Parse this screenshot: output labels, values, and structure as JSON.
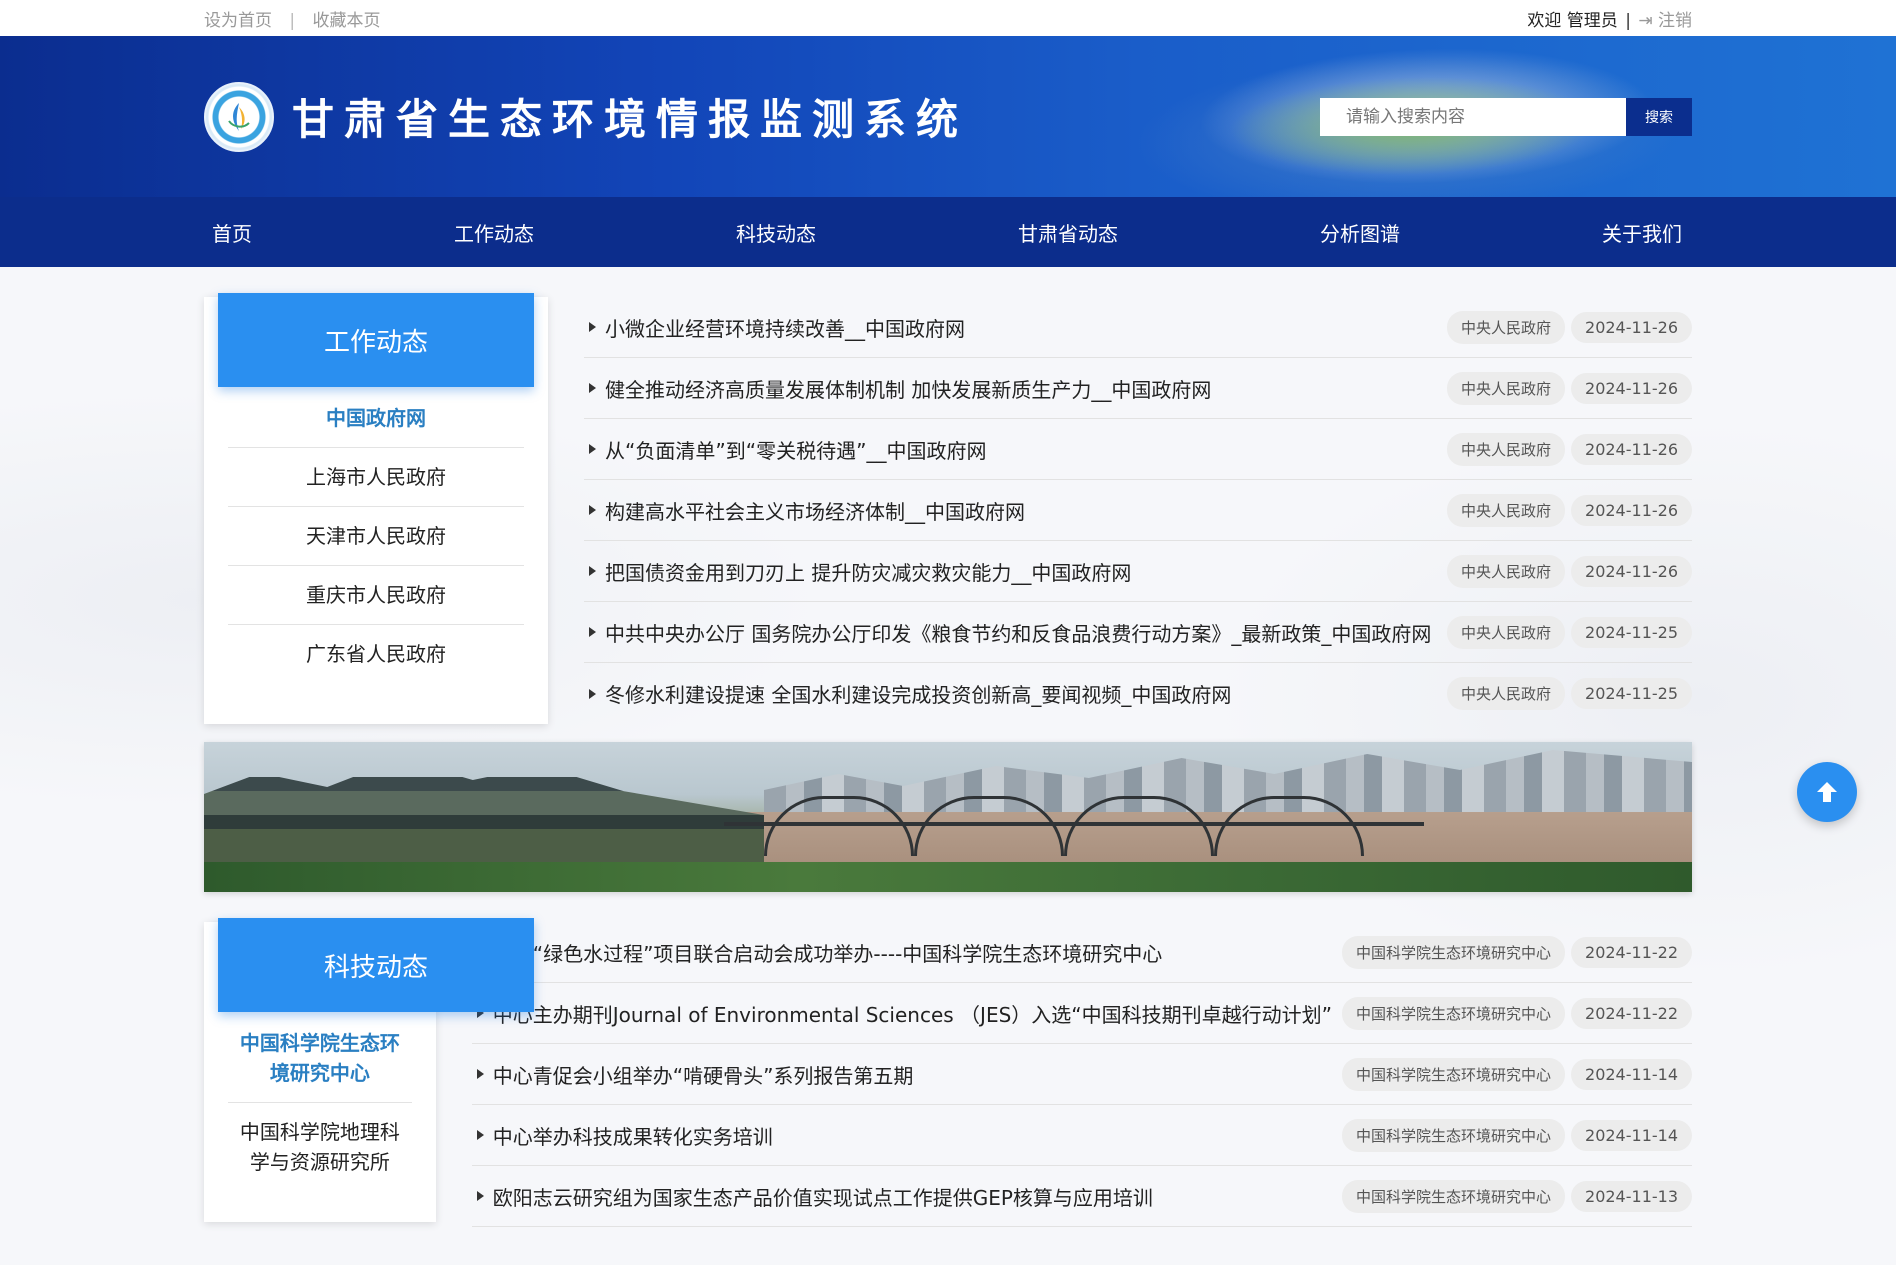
{
  "topbar": {
    "set_home": "设为首页",
    "separator": "|",
    "bookmark": "收藏本页",
    "welcome": "欢迎 管理员",
    "divider": "|",
    "logout": "注销"
  },
  "header": {
    "title": "甘肃省生态环境情报监测系统",
    "search_placeholder": "请输入搜索内容",
    "search_button": "搜索"
  },
  "nav": [
    "首页",
    "工作动态",
    "科技动态",
    "甘肃省动态",
    "分析图谱",
    "关于我们"
  ],
  "work": {
    "heading": "工作动态",
    "sources": [
      "中国政府网",
      "上海市人民政府",
      "天津市人民政府",
      "重庆市人民政府",
      "广东省人民政府"
    ],
    "items": [
      {
        "title": "小微企业经营环境持续改善__中国政府网",
        "source": "中央人民政府",
        "date": "2024-11-26"
      },
      {
        "title": "健全推动经济高质量发展体制机制 加快发展新质生产力__中国政府网",
        "source": "中央人民政府",
        "date": "2024-11-26"
      },
      {
        "title": "从“负面清单”到“零关税待遇”__中国政府网",
        "source": "中央人民政府",
        "date": "2024-11-26"
      },
      {
        "title": "构建高水平社会主义市场经济体制__中国政府网",
        "source": "中央人民政府",
        "date": "2024-11-26"
      },
      {
        "title": "把国债资金用到刀刃上 提升防灾减灾救灾能力__中国政府网",
        "source": "中央人民政府",
        "date": "2024-11-26"
      },
      {
        "title": "中共中央办公厅 国务院办公厅印发《粮食节约和反食品浪费行动方案》_最新政策_中国政府网",
        "source": "中央人民政府",
        "date": "2024-11-25"
      },
      {
        "title": "冬修水利建设提速 全国水利建设完成投资创新高_要闻视频_中国政府网",
        "source": "中央人民政府",
        "date": "2024-11-25"
      }
    ]
  },
  "tech": {
    "heading": "科技动态",
    "sources": [
      "中国科学院生态环境研究中心",
      "中国科学院地理科学与资源研究所"
    ],
    "items": [
      {
        "title": "中荷“绿色水过程”项目联合启动会成功举办----中国科学院生态环境研究中心",
        "source": "中国科学院生态环境研究中心",
        "date": "2024-11-22"
      },
      {
        "title": "中心主办期刊Journal of Environmental Sciences （JES）入选“中国科技期刊卓越行动计划”",
        "source": "中国科学院生态环境研究中心",
        "date": "2024-11-22"
      },
      {
        "title": "中心青促会小组举办“啃硬骨头”系列报告第五期",
        "source": "中国科学院生态环境研究中心",
        "date": "2024-11-14"
      },
      {
        "title": "中心举办科技成果转化实务培训",
        "source": "中国科学院生态环境研究中心",
        "date": "2024-11-14"
      },
      {
        "title": "欧阳志云研究组为国家生态产品价值实现试点工作提供GEP核算与应用培训",
        "source": "中国科学院生态环境研究中心",
        "date": "2024-11-13"
      }
    ]
  },
  "icons": {
    "logo": "logo-emblem-icon",
    "logout": "sign-out-icon",
    "back_to_top": "arrow-up-icon",
    "bullet": "caret-right-icon"
  },
  "colors": {
    "nav_bg": "#0c2d8c",
    "accent": "#2a8ff0",
    "active_link": "#2a7fc2"
  }
}
